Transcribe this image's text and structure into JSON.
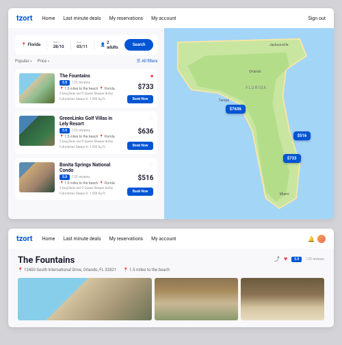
{
  "brand": "tzort",
  "nav": {
    "home": "Home",
    "deals": "Last minute deals",
    "reservations": "My reservations",
    "account": "My account",
    "signout": "Sign out"
  },
  "search": {
    "destination": "Florida",
    "start_label": "Start",
    "start": "28/10",
    "end_label": "End",
    "end": "03/11",
    "guests": "2 adults",
    "button": "Search"
  },
  "filters": {
    "popular": "Popular",
    "price": "Price",
    "all": "All filters"
  },
  "listings": [
    {
      "title": "The Fountains",
      "rating": "5.0",
      "reviews": "125 reviews",
      "dist": "1.5 miles to the beach",
      "region": "Florida",
      "amen1": "2 king Beds and 2 Queen Sleeper Sofas",
      "amen2": "Full kitchen Sleeps 8 · 1,550 Sq Ft.",
      "price": "$733",
      "book": "Book Now",
      "fav": true
    },
    {
      "title": "GreenLinks Golf Villas in Lely Resort",
      "rating": "5.0",
      "reviews": "125 reviews",
      "dist": "1.5 miles to the beach",
      "region": "Florida",
      "amen1": "2 king Beds and 2 Queen Sleeper Sofas",
      "amen2": "Full kitchen Sleeps 8 · 1,550 Sq Ft.",
      "price": "$636",
      "book": "Book Now",
      "fav": false
    },
    {
      "title": "Bonita Springs National Condo",
      "rating": "5.0",
      "reviews": "125 reviews",
      "dist": "1.5 miles to the beach",
      "region": "Florida",
      "amen1": "2 king Beds and 2 Queen Sleeper Sofas",
      "amen2": "Full kitchen Sleeps 8 · 1,550 Sq Ft.",
      "price": "$516",
      "book": "Book Now",
      "fav": false
    }
  ],
  "map": {
    "cities": {
      "tampa": "Tampa",
      "orlando": "Orlando",
      "jacksonville": "Jacksonville",
      "miami": "Miami"
    },
    "state": "FLORIDA",
    "pins": [
      "$7636",
      "$516",
      "$733"
    ]
  },
  "detail": {
    "title": "The Fountains",
    "address": "12400 South International Drive, Orlando, FL 32821",
    "dist": "1.5 miles to the beach",
    "rating": "5.0",
    "reviews": "125 reviews"
  }
}
